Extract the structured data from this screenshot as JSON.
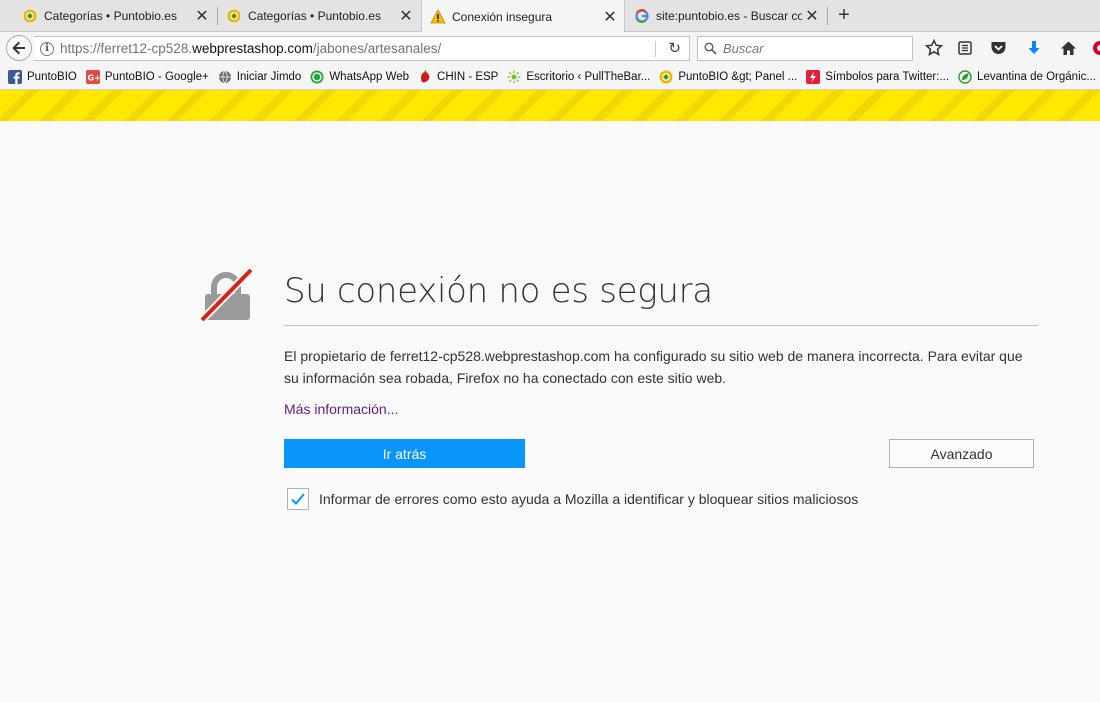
{
  "tabs": [
    {
      "title": "Categorías • Puntobio.es",
      "icon": "puntobio-favicon-icon",
      "active": false
    },
    {
      "title": "Categorías • Puntobio.es",
      "icon": "puntobio-favicon-icon",
      "active": false
    },
    {
      "title": "Conexión insegura",
      "icon": "warning-triangle-icon",
      "active": true
    },
    {
      "title": "site:puntobio.es - Buscar con",
      "icon": "google-g-icon",
      "active": false
    }
  ],
  "urlbar": {
    "prefix": "https://ferret12-cp528.",
    "host": "webprestashop.com",
    "path": "/jabones/artesanales/"
  },
  "search": {
    "placeholder": "Buscar"
  },
  "bookmarks": [
    {
      "label": "PuntoBIO",
      "icon": "facebook-icon"
    },
    {
      "label": "PuntoBIO - Google+",
      "icon": "google-plus-icon"
    },
    {
      "label": "Iniciar Jimdo",
      "icon": "globe-icon"
    },
    {
      "label": "WhatsApp Web",
      "icon": "whatsapp-icon"
    },
    {
      "label": "CHIN - ESP",
      "icon": "chili-icon"
    },
    {
      "label": "Escritorio ‹ PullTheBar...",
      "icon": "sun-icon"
    },
    {
      "label": "PuntoBIO &gt; Panel ...",
      "icon": "puntobio-favicon-icon"
    },
    {
      "label": "Símbolos para Twitter:...",
      "icon": "bolt-icon"
    },
    {
      "label": "Levantina de Orgánic...",
      "icon": "leaf-icon"
    }
  ],
  "error": {
    "title": "Su conexión no es segura",
    "description": "El propietario de ferret12-cp528.webprestashop.com ha configurado su sitio web de manera incorrecta. Para evitar que su información sea robada, Firefox no ha conectado con este sitio web.",
    "more_info": "Más información...",
    "back_button": "Ir atrás",
    "advanced_button": "Avanzado",
    "report_label": "Informar de errores como esto ayuda a Mozilla a identificar y bloquear sitios maliciosos",
    "report_checked": true
  },
  "colors": {
    "primary_button": "#0996f8",
    "stripe": "#ffe900",
    "link": "#5e1f84",
    "lock_slash": "#d92215"
  }
}
